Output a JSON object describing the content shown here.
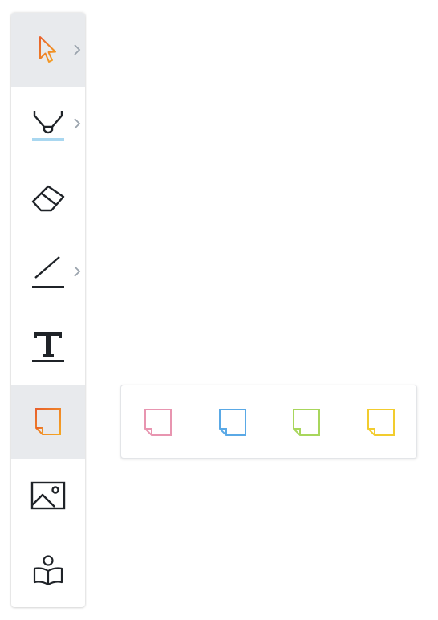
{
  "toolbar": {
    "tools": [
      {
        "id": "select",
        "icon": "cursor-arrow-icon",
        "active": true,
        "has_submenu": true
      },
      {
        "id": "pen",
        "icon": "marker-pen-icon",
        "active": false,
        "has_submenu": true,
        "underline_color": "#a9d7f0"
      },
      {
        "id": "eraser",
        "icon": "eraser-icon",
        "active": false,
        "has_submenu": false
      },
      {
        "id": "line",
        "icon": "line-icon",
        "active": false,
        "has_submenu": true
      },
      {
        "id": "text",
        "icon": "text-T-icon",
        "active": false,
        "has_submenu": false
      },
      {
        "id": "sticky-note",
        "icon": "sticky-note-icon",
        "active": true,
        "has_submenu": false
      },
      {
        "id": "image",
        "icon": "image-icon",
        "active": false,
        "has_submenu": false
      },
      {
        "id": "reader",
        "icon": "person-reading-icon",
        "active": false,
        "has_submenu": false
      }
    ],
    "active_bg": "#e8eaed",
    "accent_gradient": [
      "#f5a623",
      "#e8612c"
    ]
  },
  "sticky_note_popover": {
    "colors": [
      {
        "name": "pink",
        "hex": "#e895b0"
      },
      {
        "name": "blue",
        "hex": "#5aa9e6"
      },
      {
        "name": "green",
        "hex": "#a8d65c"
      },
      {
        "name": "yellow",
        "hex": "#f2cc2e"
      }
    ]
  }
}
